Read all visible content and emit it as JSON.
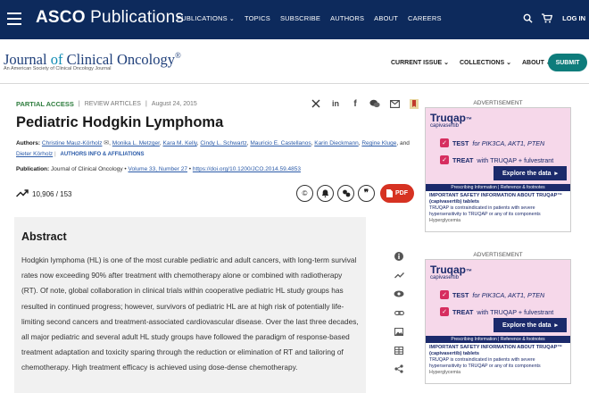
{
  "topnav": {
    "brand_bold": "ASCO",
    "brand_rest": " Publications",
    "items": [
      {
        "label": "PUBLICATIONS",
        "caret": "⌄"
      },
      {
        "label": "TOPICS"
      },
      {
        "label": "SUBSCRIBE"
      },
      {
        "label": "AUTHORS"
      },
      {
        "label": "ABOUT"
      },
      {
        "label": "CAREERS"
      }
    ],
    "login_label": "LOG IN"
  },
  "journal": {
    "name_pre": "Journal ",
    "name_of": "of",
    "name_post": " Clinical Oncology",
    "reg_mark": "®",
    "subtitle": "An American Society of Clinical Oncology Journal",
    "nav": [
      "CURRENT ISSUE ⌄",
      "COLLECTIONS ⌄",
      "ABOUT ⌄"
    ],
    "submit_label": "SUBMIT"
  },
  "article": {
    "access": "PARTIAL ACCESS",
    "sep": "|",
    "type": "REVIEW ARTICLES",
    "date": "August 24, 2015",
    "title": "Pediatric Hodgkin Lymphoma",
    "authors_label": "Authors:",
    "authors": [
      "Christine Mauz-Körholz",
      "Monika L. Metzger",
      "Kara M. Kelly",
      "Cindy L. Schwartz",
      "Mauricio E. Castellanos",
      "Karin Dieckmann",
      "Regine Kluge",
      "Dieter Körholz"
    ],
    "and": ", and",
    "affiliations_label": "AUTHORS INFO & AFFILIATIONS",
    "pub_label": "Publication:",
    "pub_journal": "Journal of Clinical Oncology",
    "pub_bullet": "•",
    "pub_volume": "Volume 33, Number 27",
    "pub_doi": "https://doi.org/10.1200/JCO.2014.59.4853",
    "metrics": "10,906 / 153",
    "pdf_label": "PDF"
  },
  "abstract": {
    "heading": "Abstract",
    "text": "Hodgkin lymphoma (HL) is one of the most curable pediatric and adult cancers, with long-term survival rates now exceeding 90% after treatment with chemotherapy alone or combined with radiotherapy (RT). Of note, global collaboration in clinical trials within cooperative pediatric HL study groups has resulted in continued progress; however, survivors of pediatric HL are at high risk of potentially life-limiting second cancers and treatment-associated cardiovascular disease. Over the last three decades, all major pediatric and several adult HL study groups have followed the paradigm of response-based treatment adaptation and toxicity sparing through the reduction or elimination of RT and tailoring of chemotherapy. High treatment efficacy is achieved using dose-dense chemotherapy."
  },
  "ads": {
    "label": "ADVERTISEMENT",
    "brand": "Truqap",
    "brand_tm": "™",
    "generic": "capivasertib",
    "row1_bold": "TEST",
    "row1_rest": " for PIK3CA, AKT1, PTEN",
    "row2_bold": "TREAT",
    "row2_rest": " with TRUQAP + fulvestrant",
    "explore": "Explore the data",
    "links": "Prescribing Information | Reference & footnotes",
    "isi_title": "IMPORTANT SAFETY INFORMATION ABOUT TRUQAP™ (capivasertib) tablets",
    "isi_body": "TRUQAP is contraindicated in patients with severe hypersensitivity to TRUQAP or any of its components",
    "isi_more": "Hyperglycemia"
  },
  "colors": {
    "nav_bg": "#0d2a5c",
    "access_green": "#2e7d3e",
    "submit_teal": "#0e7c7b",
    "pdf_red": "#d63222",
    "ad_navy": "#1b2a6b",
    "ad_pink": "#d62d5f"
  }
}
